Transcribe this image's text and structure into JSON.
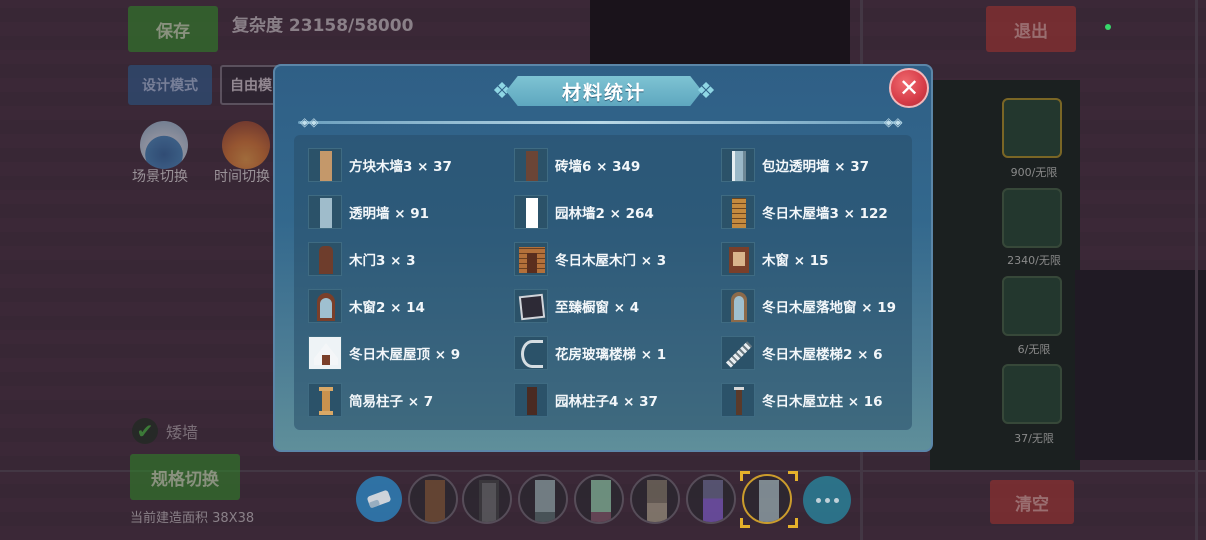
{
  "hud": {
    "save_label": "保存",
    "complexity": "复杂度 23158/58000",
    "design_mode_label": "设计模式",
    "free_mode_label": "自由模",
    "exit_label": "退出",
    "scene_switch_label": "场景切换",
    "time_switch_label": "时间切换",
    "short_wall_label": "矮墙",
    "spec_switch_label": "规格切换",
    "build_area": "当前建造面积 38X38",
    "clear_label": "清空",
    "right_counts": [
      "900/无限",
      "2340/无限",
      "6/无限",
      "37/无限"
    ]
  },
  "modal": {
    "title": "材料统计",
    "close_icon": "close-x-icon",
    "items": [
      {
        "name": "方块木墙3 × 37",
        "icon": "wood-block-wall"
      },
      {
        "name": "砖墙6 × 349",
        "icon": "brick-wall"
      },
      {
        "name": "包边透明墙 × 37",
        "icon": "framed-glass-wall"
      },
      {
        "name": "透明墙 × 91",
        "icon": "glass-wall"
      },
      {
        "name": "园林墙2 × 264",
        "icon": "garden-wall"
      },
      {
        "name": "冬日木屋墙3 × 122",
        "icon": "winter-cabin-wall"
      },
      {
        "name": "木门3 × 3",
        "icon": "wood-door"
      },
      {
        "name": "冬日木屋木门 × 3",
        "icon": "winter-cabin-door"
      },
      {
        "name": "木窗 × 15",
        "icon": "wood-window"
      },
      {
        "name": "木窗2 × 14",
        "icon": "wood-window-arched"
      },
      {
        "name": "至臻橱窗 × 4",
        "icon": "display-window"
      },
      {
        "name": "冬日木屋落地窗 × 19",
        "icon": "winter-cabin-french-window"
      },
      {
        "name": "冬日木屋屋顶 × 9",
        "icon": "winter-cabin-roof"
      },
      {
        "name": "花房玻璃楼梯 × 1",
        "icon": "greenhouse-glass-stairs"
      },
      {
        "name": "冬日木屋楼梯2 × 6",
        "icon": "winter-cabin-stairs"
      },
      {
        "name": "简易柱子 × 7",
        "icon": "simple-pillar"
      },
      {
        "name": "园林柱子4 × 37",
        "icon": "garden-pillar"
      },
      {
        "name": "冬日木屋立柱 × 16",
        "icon": "winter-cabin-post"
      }
    ]
  },
  "colors": {
    "modal_bg": "#33688d",
    "title_banner": "#6bb5c9",
    "close_button": "#d63c48",
    "accent_green": "#2f8a28",
    "accent_red": "#a6332f",
    "selection_gold": "#e5b12b"
  }
}
